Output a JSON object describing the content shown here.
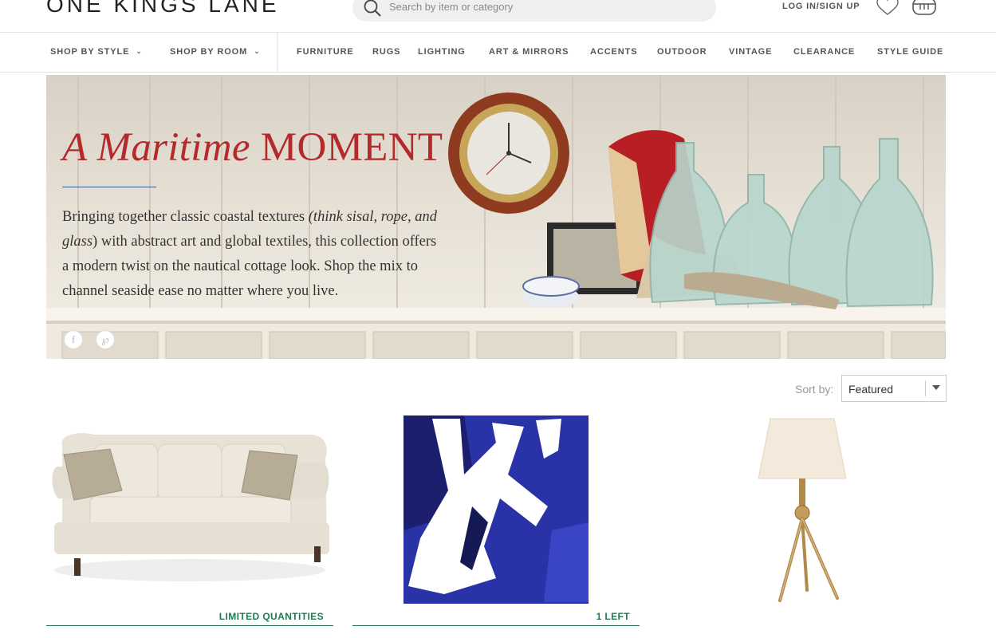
{
  "header": {
    "logo": "ONE KINGS LANE",
    "search_placeholder": "Search by item or category",
    "login_label": "LOG IN/SIGN UP"
  },
  "nav": {
    "items": [
      {
        "label": "SHOP BY STYLE",
        "dropdown": true
      },
      {
        "label": "SHOP BY ROOM",
        "dropdown": true
      },
      {
        "label": "FURNITURE"
      },
      {
        "label": "RUGS"
      },
      {
        "label": "LIGHTING"
      },
      {
        "label": "ART & MIRRORS"
      },
      {
        "label": "ACCENTS"
      },
      {
        "label": "OUTDOOR"
      },
      {
        "label": "VINTAGE"
      },
      {
        "label": "CLEARANCE"
      },
      {
        "label": "STYLE GUIDE"
      }
    ]
  },
  "hero": {
    "title_italic": "A Maritime",
    "title_caps": "MOMENT",
    "body_start": "Bringing together classic coastal textures ",
    "body_italic": "(think sisal, rope, and glass",
    "body_paren": ")",
    "body_end": " with abstract art and global textiles, this collection offers a modern twist on the nautical cottage look. Shop the mix to channel seaside ease no matter where you live.",
    "accent_color": "#b42a2c"
  },
  "sort": {
    "label": "Sort by:",
    "selected": "Featured"
  },
  "products": [
    {
      "name": "sofa",
      "badge": "LIMITED QUANTITIES"
    },
    {
      "name": "abstract-painting",
      "badge": "1 LEFT"
    },
    {
      "name": "tripod-lamp",
      "badge": ""
    }
  ],
  "colors": {
    "badge": "#1f7a52",
    "rule": "#3a5a8c"
  }
}
